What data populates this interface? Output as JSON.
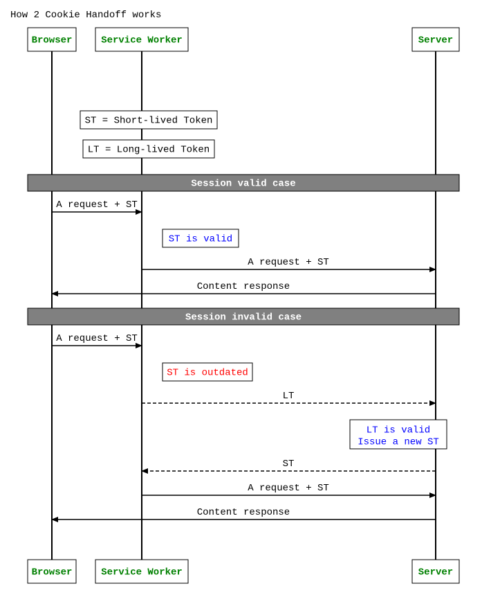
{
  "title": "How 2 Cookie Handoff works",
  "participants": {
    "browser": "Browser",
    "service_worker": "Service Worker",
    "server": "Server"
  },
  "notes": {
    "st_def": "ST = Short-lived Token",
    "lt_def": "LT = Long-lived Token",
    "st_valid": "ST is valid",
    "st_outdated": "ST is outdated",
    "lt_valid_1": "LT is valid",
    "lt_valid_2": "Issue a new ST"
  },
  "dividers": {
    "valid": "Session valid case",
    "invalid": "Session invalid case"
  },
  "messages": {
    "req_st": "A request + ST",
    "content": "Content response",
    "lt": "LT",
    "st": "ST"
  },
  "chart_data": {
    "type": "sequence_diagram",
    "participants": [
      "Browser",
      "Service Worker",
      "Server"
    ],
    "steps": [
      {
        "type": "note",
        "over": "Service Worker",
        "text": "ST = Short-lived Token"
      },
      {
        "type": "note",
        "over": "Service Worker",
        "text": "LT = Long-lived Token"
      },
      {
        "type": "divider",
        "text": "Session valid case"
      },
      {
        "type": "message",
        "from": "Browser",
        "to": "Service Worker",
        "text": "A request + ST",
        "style": "solid"
      },
      {
        "type": "note",
        "over": "Service Worker",
        "text": "ST is valid",
        "color": "blue"
      },
      {
        "type": "message",
        "from": "Service Worker",
        "to": "Server",
        "text": "A request + ST",
        "style": "solid"
      },
      {
        "type": "message",
        "from": "Server",
        "to": "Browser",
        "text": "Content response",
        "style": "solid"
      },
      {
        "type": "divider",
        "text": "Session invalid case"
      },
      {
        "type": "message",
        "from": "Browser",
        "to": "Service Worker",
        "text": "A request + ST",
        "style": "solid"
      },
      {
        "type": "note",
        "over": "Service Worker",
        "text": "ST is outdated",
        "color": "red"
      },
      {
        "type": "message",
        "from": "Service Worker",
        "to": "Server",
        "text": "LT",
        "style": "dashed"
      },
      {
        "type": "note",
        "over": "Server",
        "text": "LT is valid\nIssue a new ST",
        "color": "blue"
      },
      {
        "type": "message",
        "from": "Server",
        "to": "Service Worker",
        "text": "ST",
        "style": "dashed"
      },
      {
        "type": "message",
        "from": "Service Worker",
        "to": "Server",
        "text": "A request + ST",
        "style": "solid"
      },
      {
        "type": "message",
        "from": "Server",
        "to": "Browser",
        "text": "Content response",
        "style": "solid"
      }
    ]
  }
}
